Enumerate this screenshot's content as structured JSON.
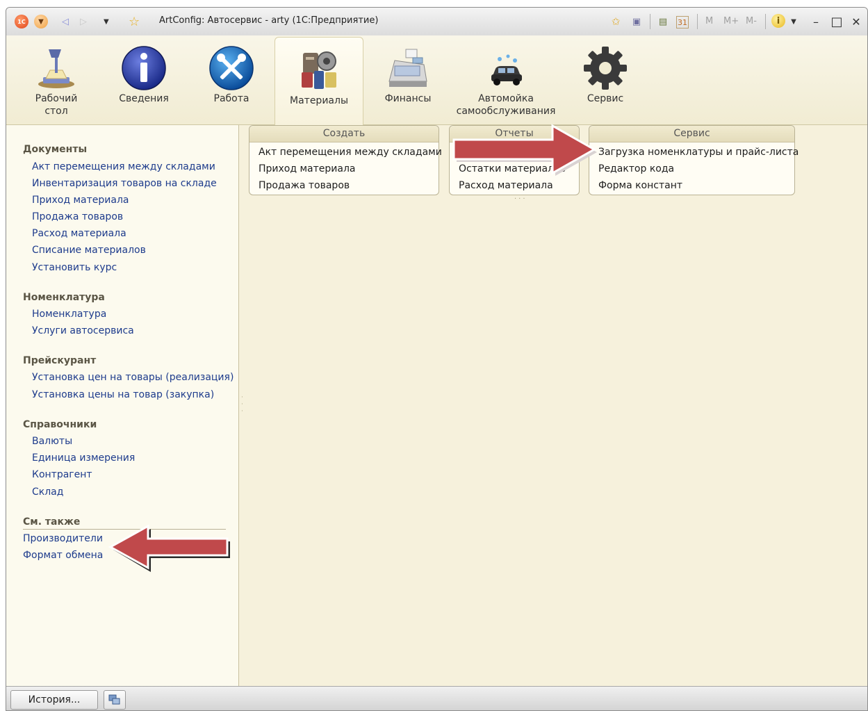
{
  "window": {
    "title": "ArtConfig: Автосервис - arty  (1С:Предприятие)",
    "toolbar_right": {
      "m": "M",
      "m_plus": "M+",
      "m_minus": "M-"
    },
    "window_controls": {
      "minimize": "–",
      "maximize": "□",
      "close": "✕"
    }
  },
  "sections": [
    {
      "label_line1": "Рабочий",
      "label_line2": "стол",
      "icon": "desk-lamp-icon"
    },
    {
      "label_line1": "Сведения",
      "label_line2": "",
      "icon": "info-icon"
    },
    {
      "label_line1": "Работа",
      "label_line2": "",
      "icon": "tools-icon"
    },
    {
      "label_line1": "Материалы",
      "label_line2": "",
      "icon": "parts-icon",
      "active": true
    },
    {
      "label_line1": "Финансы",
      "label_line2": "",
      "icon": "cash-register-icon"
    },
    {
      "label_line1": "Автомойка",
      "label_line2": "самообслуживания",
      "icon": "car-wash-icon"
    },
    {
      "label_line1": "Сервис",
      "label_line2": "",
      "icon": "gear-icon"
    }
  ],
  "nav": {
    "documents": {
      "title": "Документы",
      "items": [
        "Акт перемещения между складами",
        "Инвентаризация товаров на складе",
        "Приход материала",
        "Продажа товаров",
        "Расход материала",
        "Списание материалов",
        "Установить курс"
      ]
    },
    "nomenclature": {
      "title": "Номенклатура",
      "items": [
        "Номенклатура",
        "Услуги автосервиса"
      ]
    },
    "pricelist": {
      "title": "Прейскурант",
      "items": [
        "Установка цен на товары (реализация)",
        "Установка цены на товар (закупка)"
      ]
    },
    "catalogs": {
      "title": "Справочники",
      "items": [
        "Валюты",
        "Единица измерения",
        "Контрагент",
        "Склад"
      ]
    },
    "see_also": {
      "title": "См. также",
      "items": [
        "Производители",
        "Формат обмена"
      ]
    }
  },
  "commands": {
    "create": {
      "title": "Создать",
      "items": [
        "Акт перемещения между складами",
        "Приход материала",
        "Продажа товаров"
      ]
    },
    "reports": {
      "title": "Отчеты",
      "items": [
        "Остатки материалов",
        "Расход материала"
      ]
    },
    "service": {
      "title": "Сервис",
      "items": [
        "Загрузка номенклатуры и прайс-листа",
        "Редактор кода",
        "Форма констант"
      ]
    }
  },
  "statusbar": {
    "history_label": "История..."
  },
  "colors": {
    "background": "#f6f1dc",
    "link": "#1d3b8c",
    "arrow": "#c0494b"
  }
}
